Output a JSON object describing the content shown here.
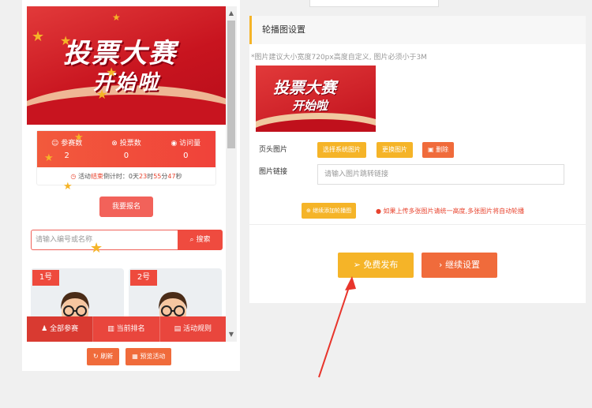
{
  "preview": {
    "banner": {
      "title_line1": "投票大赛",
      "title_line2": "开始啦"
    },
    "stats": [
      {
        "label": "参赛数",
        "value": "2",
        "icon": "user-icon"
      },
      {
        "label": "投票数",
        "value": "0",
        "icon": "vote-icon"
      },
      {
        "label": "访问量",
        "value": "0",
        "icon": "eye-icon"
      }
    ],
    "countdown": {
      "prefix": "活动",
      "status": "结束",
      "middle": "倒计时：0天",
      "hours": "23",
      "h_unit": "时",
      "minutes": "55",
      "m_unit": "分",
      "seconds": "47",
      "s_unit": "秒"
    },
    "signup_label": "我要报名",
    "search": {
      "placeholder": "请输入编号或名称",
      "button": "搜索"
    },
    "cards": [
      {
        "number": "1号"
      },
      {
        "number": "2号"
      }
    ],
    "bottom_nav": [
      {
        "label": "全部参赛",
        "icon": "user-icon"
      },
      {
        "label": "当前排名",
        "icon": "ranking-icon"
      },
      {
        "label": "活动规则",
        "icon": "rules-icon"
      }
    ],
    "actions": {
      "refresh": "刷新",
      "preview": "预览活动"
    }
  },
  "settings": {
    "section_title": "轮播图设置",
    "hint": "*图片建议大小宽度720px高度自定义, 图片必须小于3M",
    "thumbnail": {
      "line1": "投票大赛",
      "line2": "开始啦"
    },
    "header_image_label": "页头图片",
    "choose_system_image": "选择系统图片",
    "replace_image": "更换图片",
    "delete": "删除",
    "image_link_label": "图片链接",
    "image_link_placeholder": "请输入图片跳转链接",
    "add_carousel": "继续添加轮播图",
    "add_tip": "如果上传多张图片请统一高度,多张图片将自动轮播",
    "publish": "免费发布",
    "continue": "继续设置"
  },
  "colors": {
    "primary_red": "#ef4b3f",
    "accent_yellow": "#f5b428",
    "orange": "#f06b3b",
    "annotation_red": "#e8352c"
  }
}
